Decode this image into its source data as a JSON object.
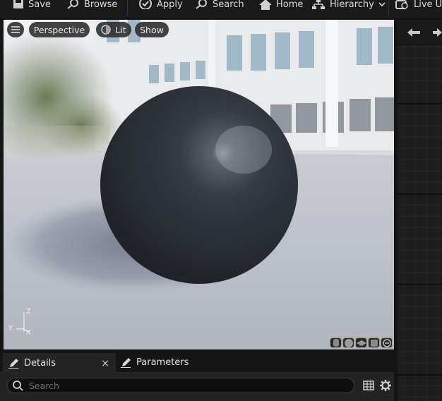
{
  "toolbar": {
    "save": "Save",
    "browse": "Browse",
    "apply": "Apply",
    "search": "Search",
    "home": "Home",
    "hierarchy": "Hierarchy",
    "live_update": "Live Up"
  },
  "viewport": {
    "perspective": "Perspective",
    "lit": "Lit",
    "show": "Show",
    "axis_z": "Z",
    "axis_y": "Y",
    "axis_x": "X"
  },
  "tabs": {
    "details": "Details",
    "close": "×",
    "parameters": "Parameters"
  },
  "details": {
    "search_placeholder": "Search"
  },
  "icons": [
    "save-icon",
    "browse-icon",
    "apply-icon",
    "search-icon",
    "home-icon",
    "hierarchy-icon",
    "chevron-down-icon",
    "live-update-icon",
    "menu-icon",
    "lit-icon",
    "back-arrow-icon",
    "pencil-icon",
    "table-icon",
    "gear-icon"
  ]
}
